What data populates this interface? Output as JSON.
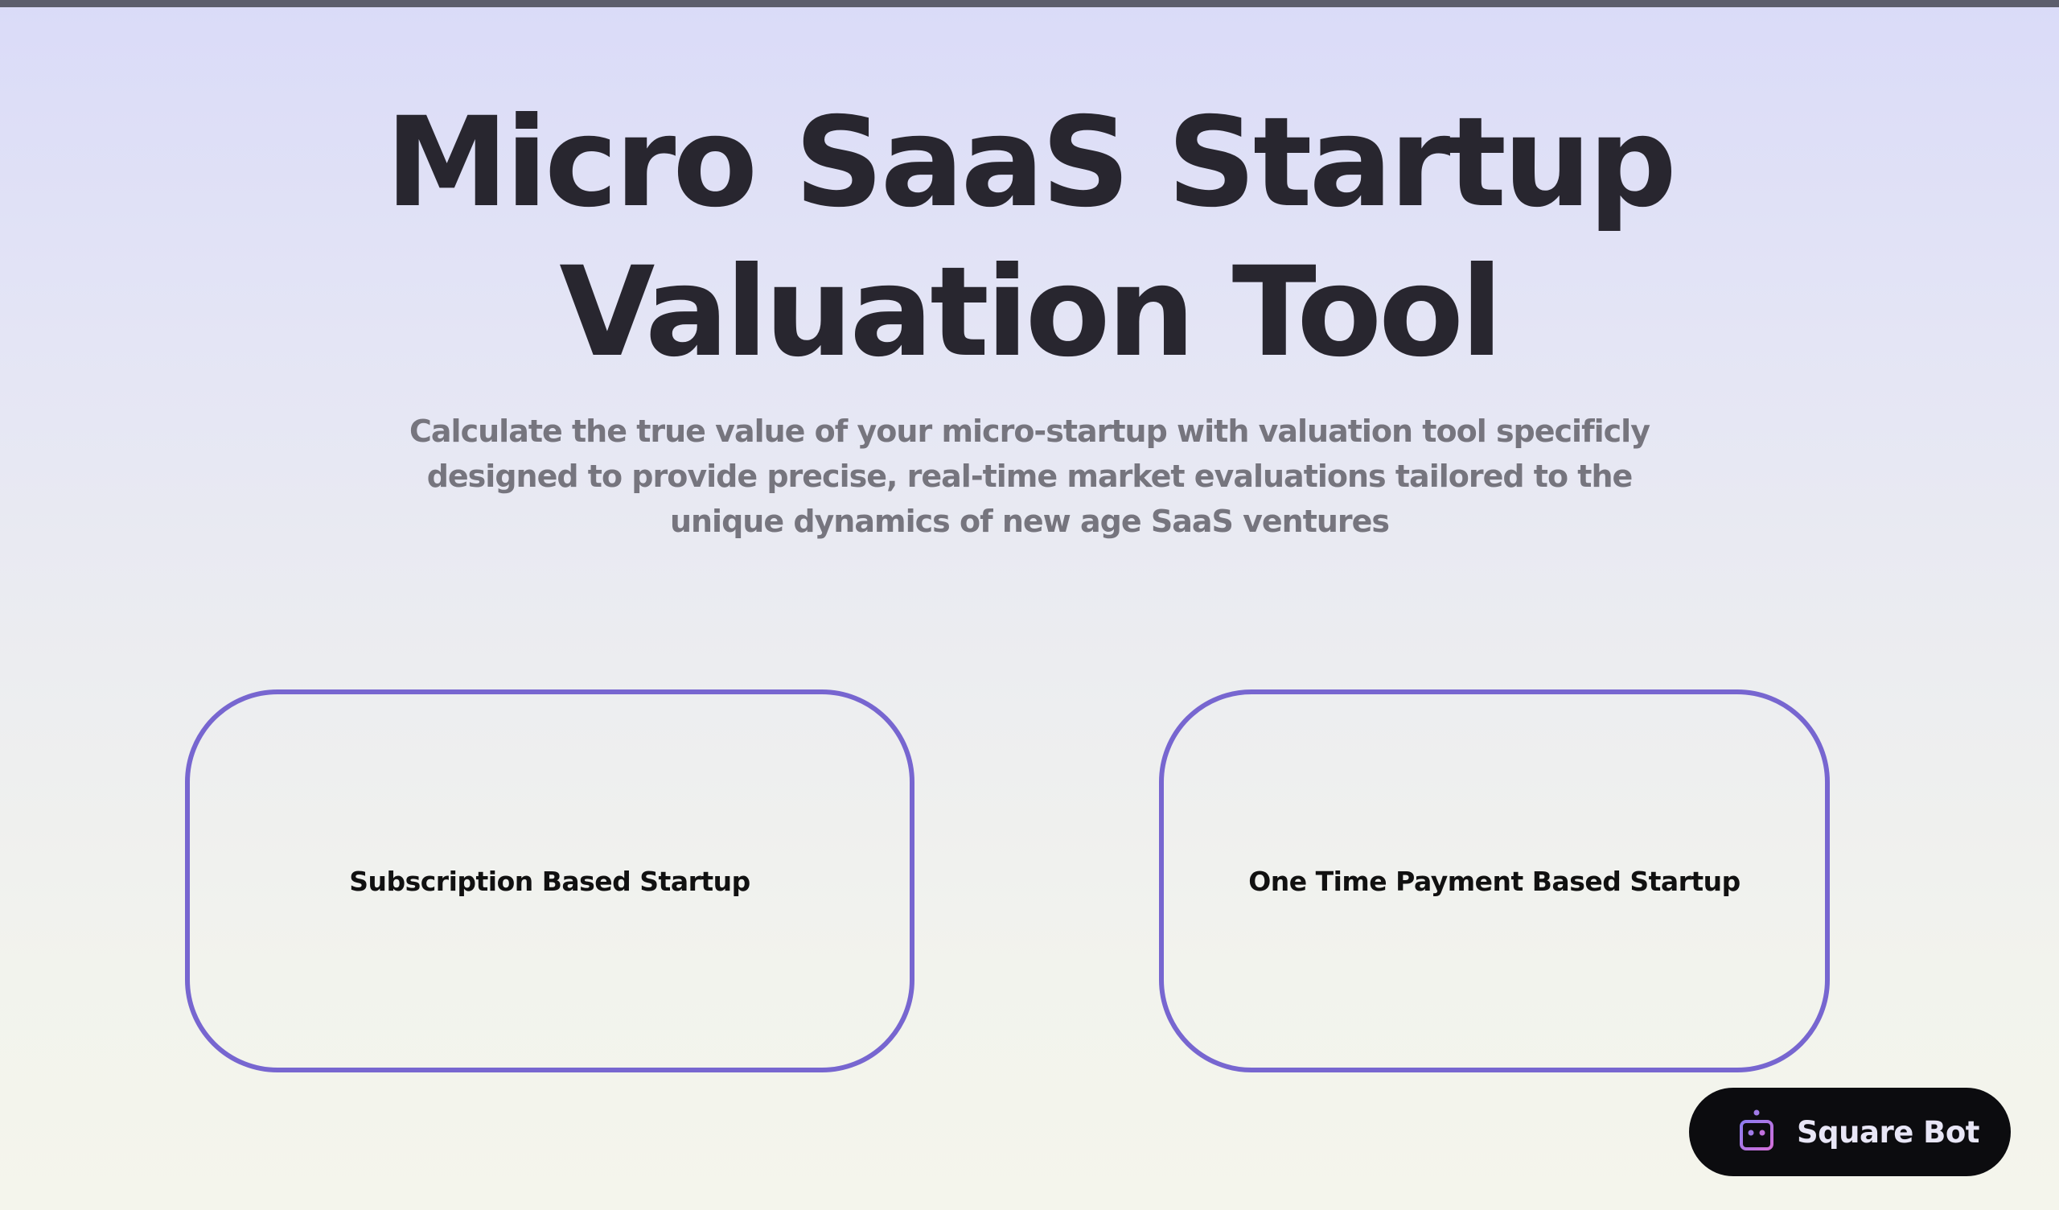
{
  "hero": {
    "title_line1": "Micro SaaS Startup",
    "title_line2": "Valuation Tool",
    "description": "Calculate the true value of your micro-startup with valuation tool specificly designed to provide precise, real-time market evaluations tailored to the unique dynamics of new age SaaS ventures"
  },
  "options": [
    {
      "label": "Subscription Based Startup"
    },
    {
      "label": "One Time Payment Based Startup"
    }
  ],
  "chat_widget": {
    "label": "Square Bot",
    "icon": "robot-icon"
  },
  "colors": {
    "accent": "#7766d0",
    "title": "#28262f",
    "subtitle": "#76757e",
    "bot_background": "#0c0c0f"
  }
}
